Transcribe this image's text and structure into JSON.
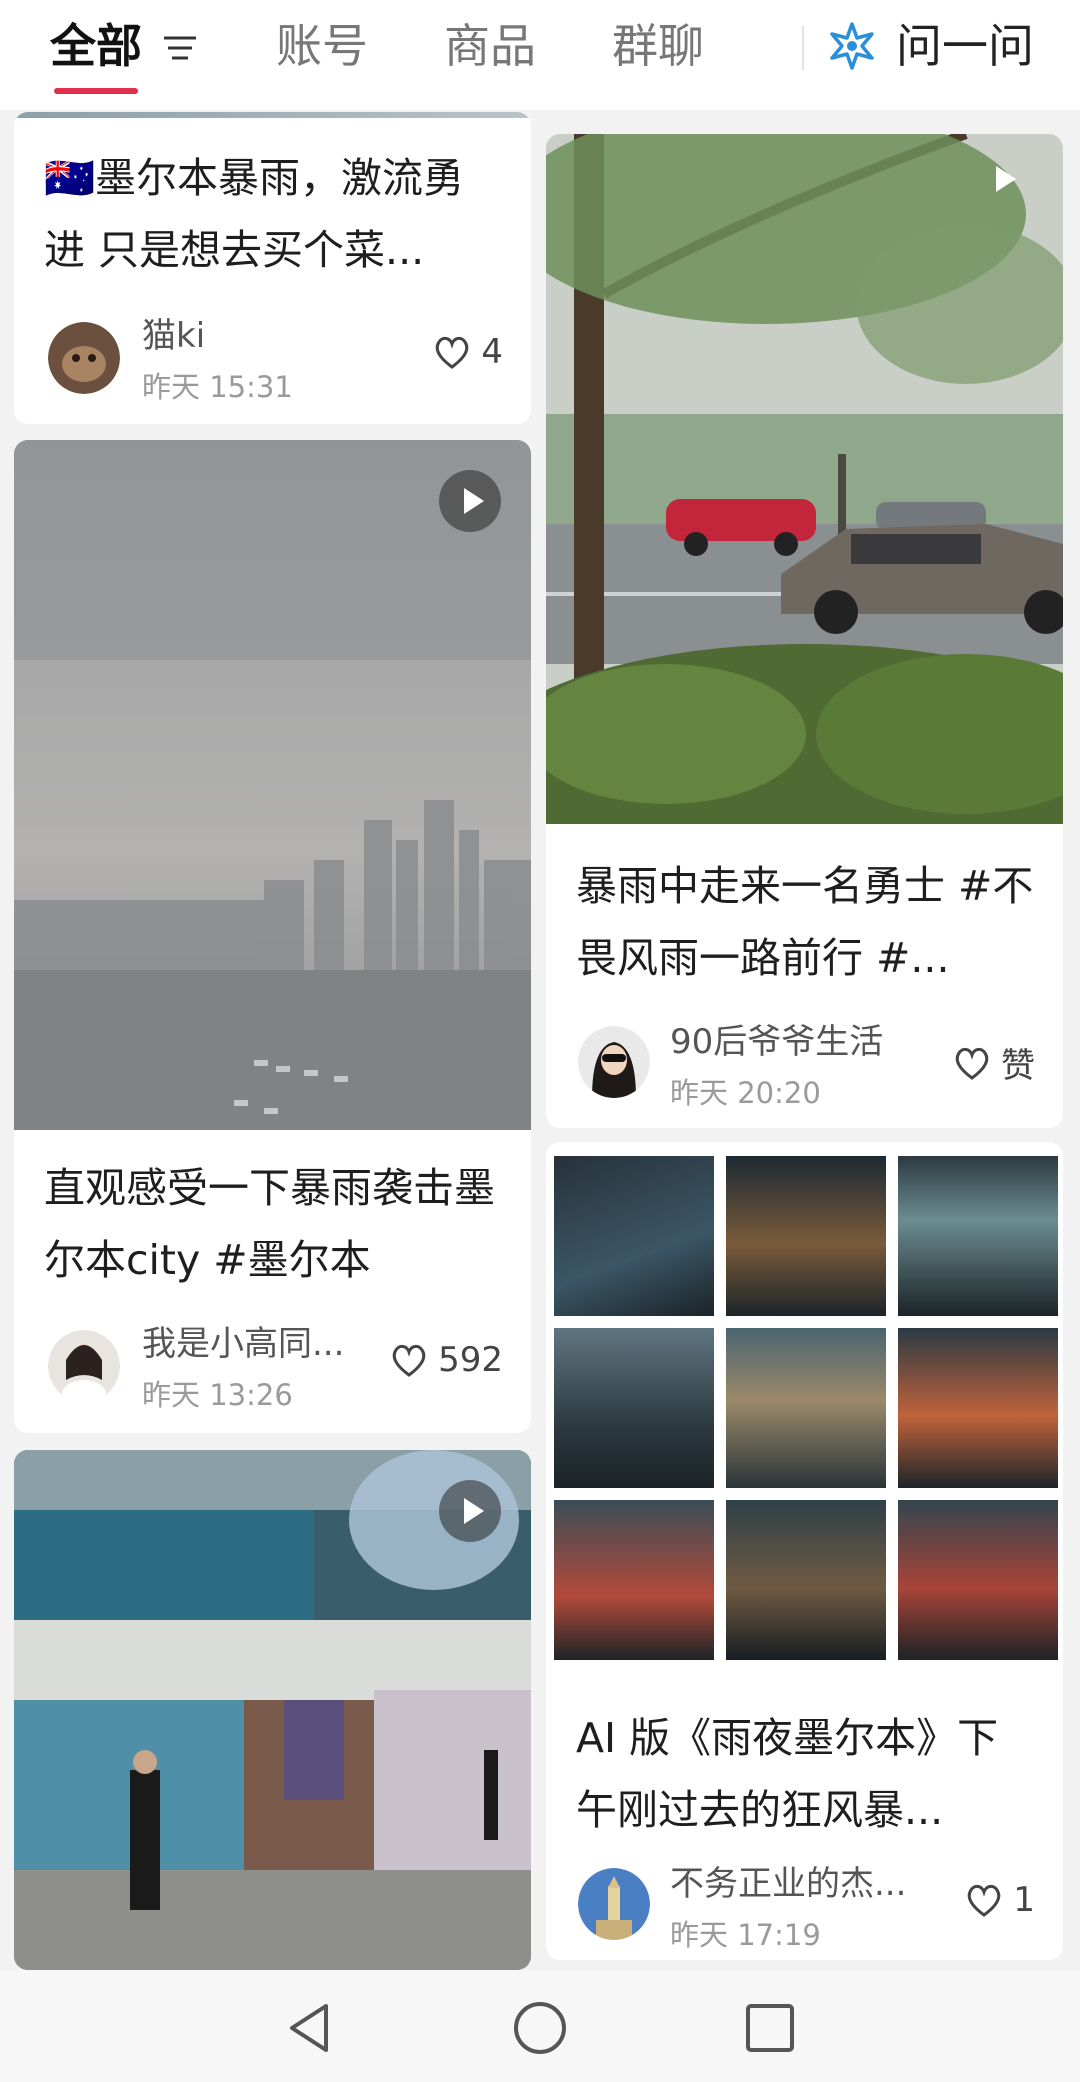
{
  "tabs": [
    {
      "label": "全部",
      "active": true
    },
    {
      "label": "账号",
      "active": false
    },
    {
      "label": "商品",
      "active": false
    },
    {
      "label": "群聊",
      "active": false
    }
  ],
  "ask": {
    "label": "问一问",
    "icon": "ai-star-icon"
  },
  "accent_color": "#e0304a",
  "cards": [
    {
      "id": "card1",
      "title": "🇦🇺墨尔本暴雨，激流勇进 只是想去买个菜...",
      "author": "猫ki",
      "time": "昨天 15:31",
      "likes": "4",
      "is_video": false
    },
    {
      "id": "card2",
      "title": "暴雨中走来一名勇士 #不畏风雨一路前行 #...",
      "author": "90后爷爷生活",
      "time": "昨天 20:20",
      "likes": "赞",
      "is_video": true
    },
    {
      "id": "card3",
      "title": "直观感受一下暴雨袭击墨尔本city #墨尔本",
      "author": "我是小高同...",
      "time": "昨天 13:26",
      "likes": "592",
      "is_video": true
    },
    {
      "id": "card5",
      "title": "AI 版《雨夜墨尔本》下午刚过去的狂风暴...",
      "author": "不务正业的杰...",
      "time": "昨天 17:19",
      "likes": "1",
      "is_video": false
    },
    {
      "id": "card4",
      "is_video": true
    }
  ],
  "navbar": {
    "icons": [
      "back-triangle-icon",
      "home-circle-icon",
      "recents-square-icon"
    ]
  }
}
